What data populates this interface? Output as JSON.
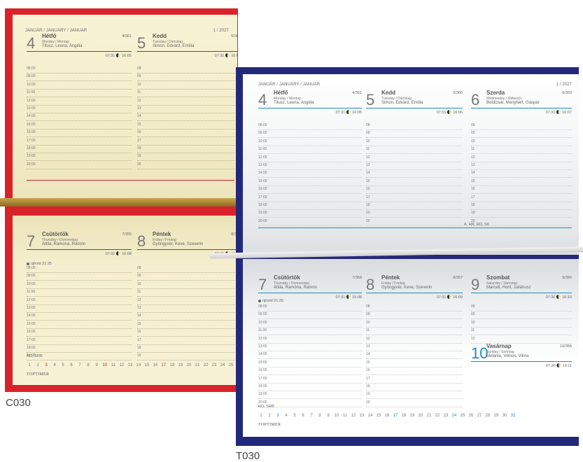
{
  "captions": {
    "c": "C030",
    "t": "T030"
  },
  "header": {
    "month": "JANUÁR / JANUARY / JANUAR",
    "week": "1 / 2027"
  },
  "days_top": [
    {
      "num": "4",
      "name": "Hétfő",
      "sub": "Monday / Montag",
      "names": "Titusz, Leona, Angéla",
      "count": "4/361",
      "sun": "07:31 🌓 16:05"
    },
    {
      "num": "5",
      "name": "Kedd",
      "sub": "Tuesday / Dienstag",
      "names": "Simon, Edvárd, Emília",
      "count": "5/360",
      "sun": "07:31 🌓 16:06"
    },
    {
      "num": "6",
      "name": "Szerda",
      "sub": "Wednesday / Mittwoch",
      "names": "Boldizsár, Menyhért, Gáspár",
      "count": "6/359",
      "sun": "07:31 🌓 16:07"
    }
  ],
  "days_bottom_c": [
    {
      "num": "7",
      "name": "Csütörtök",
      "sub": "Thursday / Donnerstag",
      "names": "Attila, Ramóna, Ramón",
      "count": "7/355",
      "sun": "07:31 🌓 16:08"
    },
    {
      "num": "8",
      "name": "Péntek",
      "sub": "Friday / Freitag",
      "names": "Gyöngyvér, Keve, Szeverin",
      "count": "8/357",
      "sun": "07:31 🌓 16:09"
    }
  ],
  "days_bottom_t": [
    {
      "num": "7",
      "name": "Csütörtök",
      "sub": "Thursday / Donnerstag",
      "names": "Attila, Ramóna, Ramón",
      "count": "7/358",
      "sun": "07:31 🌓 16:08"
    },
    {
      "num": "8",
      "name": "Péntek",
      "sub": "Friday / Freitag",
      "names": "Gyöngyvér, Keve, Szeverin",
      "count": "8/357",
      "sun": "07:31 🌓 16:09"
    },
    {
      "num": "9",
      "name": "Szombat",
      "sub": "Saturday / Samstag",
      "names": "Marcell, Hont, Juliánusz",
      "count": "9/356",
      "sun": "07:30 🌓 16:10"
    },
    {
      "num": "10",
      "name": "Vasárnap",
      "sub": "Sunday / Sonntag",
      "names": "Melánia, Vilmos, Vilma",
      "count": "10/355",
      "sun": "07:30 🌓 16:11"
    }
  ],
  "hours_full": [
    "08:00",
    "09:00",
    "10:00",
    "11:00",
    "12:00",
    "13:00",
    "14:00",
    "15:00",
    "16:00",
    "17:00",
    "18:00",
    "19:00",
    "20:00"
  ],
  "hours_short": [
    "08",
    "09",
    "10",
    "11",
    "12",
    "13",
    "14",
    "15",
    "16",
    "17",
    "18",
    "19",
    "20"
  ],
  "moon_note": "újhold 21:25",
  "holiday_note_top": "A, HR, RO, SK",
  "holiday_note_bot": "RO, SRB",
  "mini_cal": [
    "1",
    "2",
    "3",
    "4",
    "5",
    "6",
    "7",
    "8",
    "9",
    "10",
    "11",
    "12",
    "13",
    "14",
    "15",
    "16",
    "17",
    "18",
    "19",
    "20",
    "21",
    "22",
    "23",
    "24",
    "25",
    "26",
    "27",
    "28",
    "29",
    "30",
    "31"
  ],
  "brand": "TOPTIMER",
  "colors": {
    "red": "#d8232a",
    "navy": "#23297a",
    "blue": "#1a8fc2"
  }
}
